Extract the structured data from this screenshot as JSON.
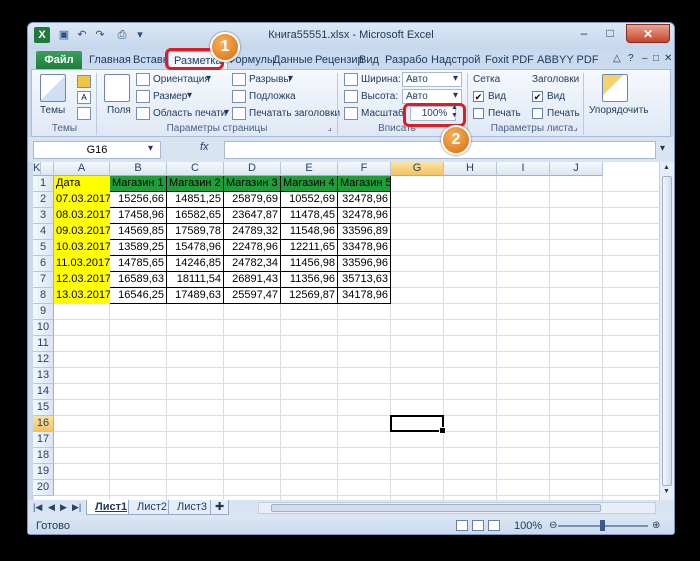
{
  "window": {
    "title": "Книга55551.xlsx - Microsoft Excel"
  },
  "quick_access": [
    "save-icon",
    "undo-icon",
    "redo-icon",
    "print-preview-icon"
  ],
  "ribbon_tabs": [
    "Файл",
    "Главная",
    "Вставка",
    "Разметка",
    "Формулы",
    "Данные",
    "Рецензир",
    "Вид",
    "Разрабо",
    "Надстрой",
    "Foxit PDF",
    "ABBYY PDF"
  ],
  "ribbon": {
    "themes": {
      "button": "Темы",
      "group": "Темы"
    },
    "page_setup": {
      "margins": "Поля",
      "orientation": "Ориентация",
      "size": "Размер",
      "print_area": "Область печати",
      "breaks": "Разрывы",
      "background": "Подложка",
      "print_titles": "Печатать заголовки",
      "group": "Параметры страницы"
    },
    "scale": {
      "width_label": "Ширина:",
      "width_value": "Авто",
      "height_label": "Высота:",
      "height_value": "Авто",
      "scale_label": "Масштаб:",
      "scale_value": "100%",
      "group": "Вписать"
    },
    "sheet_options": {
      "gridlines": "Сетка",
      "headings": "Заголовки",
      "view": "Вид",
      "print": "Печать",
      "gridlines_view": true,
      "gridlines_print": false,
      "headings_view": true,
      "headings_print": false,
      "group": "Параметры листа"
    },
    "arrange": {
      "button": "Упорядочить"
    }
  },
  "formula_bar": {
    "name_box": "G16",
    "fx": "fx",
    "value": ""
  },
  "columns": [
    "A",
    "B",
    "C",
    "D",
    "E",
    "F",
    "G",
    "H",
    "I",
    "J",
    "K"
  ],
  "selected_column": "G",
  "selected_row": 16,
  "rows": [
    1,
    2,
    3,
    4,
    5,
    6,
    7,
    8,
    9,
    10,
    11,
    12,
    13,
    14,
    15,
    16,
    17,
    18,
    19,
    20
  ],
  "table": {
    "headers": [
      "Дата",
      "Магазин 1",
      "Магазин 2",
      "Магазин 3",
      "Магазин 4",
      "Магазин 5"
    ],
    "rows": [
      [
        "07.03.2017",
        "15256,66",
        "14851,25",
        "25879,69",
        "10552,69",
        "32478,96"
      ],
      [
        "08.03.2017",
        "17458,96",
        "16582,65",
        "23647,87",
        "11478,45",
        "32478,96"
      ],
      [
        "09.03.2017",
        "14569,85",
        "17589,78",
        "24789,32",
        "11548,96",
        "33596,89"
      ],
      [
        "10.03.2017",
        "13589,25",
        "15478,96",
        "22478,96",
        "12211,65",
        "33478,96"
      ],
      [
        "11.03.2017",
        "14785,65",
        "14246,85",
        "24782,34",
        "11456,98",
        "33596,96"
      ],
      [
        "12.03.2017",
        "16589,63",
        "18111,54",
        "26891,43",
        "11356,96",
        "35713,63"
      ],
      [
        "13.03.2017",
        "16546,25",
        "17489,63",
        "25597,47",
        "12569,87",
        "34178,96"
      ]
    ]
  },
  "sheets": [
    "Лист1",
    "Лист2",
    "Лист3"
  ],
  "active_sheet": "Лист1",
  "status": {
    "ready": "Готово",
    "zoom": "100%"
  },
  "callouts": [
    "1",
    "2"
  ],
  "colors": {
    "header_green": "#1f9d3a",
    "date_yellow": "#ffff00",
    "highlight_red": "#e11b22",
    "badge_orange": "#e8861f"
  }
}
